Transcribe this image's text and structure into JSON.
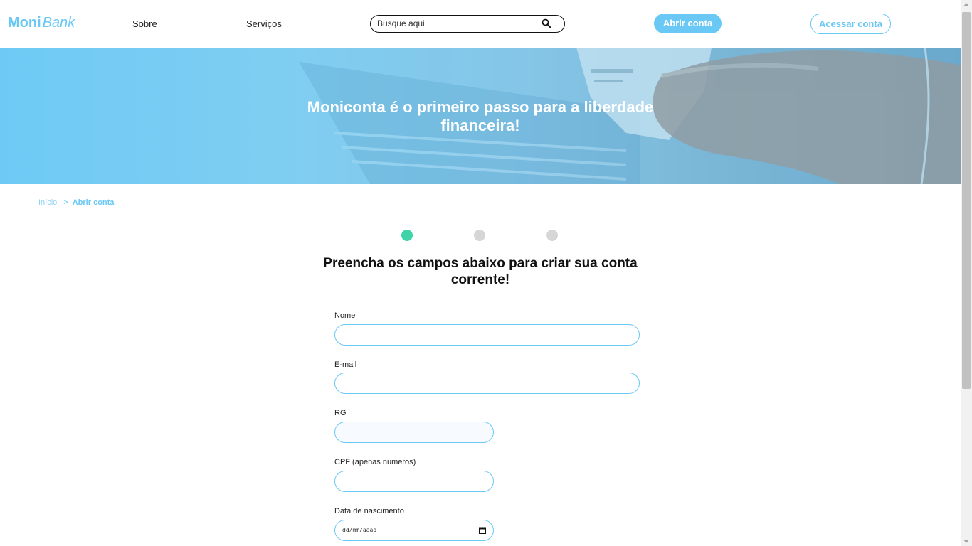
{
  "brand": {
    "logo_bold": "Moni",
    "logo_italic": "Bank",
    "accent": "#6ac8f5",
    "step_active": "#3fd3a7"
  },
  "nav": {
    "about": "Sobre",
    "services": "Serviços"
  },
  "search": {
    "placeholder": "Busque aqui",
    "value": "",
    "icon": "search-icon"
  },
  "header_buttons": {
    "open_account": "Abrir conta",
    "access_account": "Acessar conta"
  },
  "hero": {
    "title": "Moniconta é o primeiro passo para a liberdade financeira!"
  },
  "breadcrumb": {
    "home": "Início",
    "separator": ">",
    "current": "Abrir conta"
  },
  "steps": {
    "total": 3,
    "current": 1
  },
  "form": {
    "title": "Preencha os campos abaixo para criar sua conta corrente!",
    "fields": [
      {
        "label": "Nome",
        "value": ""
      },
      {
        "label": "E-mail",
        "value": ""
      },
      {
        "label": "RG",
        "value": ""
      },
      {
        "label": "CPF (apenas números)",
        "value": ""
      },
      {
        "label": "Data de nascimento",
        "placeholder": "dd/mm/aaaa",
        "icon": "calendar-icon"
      }
    ]
  }
}
